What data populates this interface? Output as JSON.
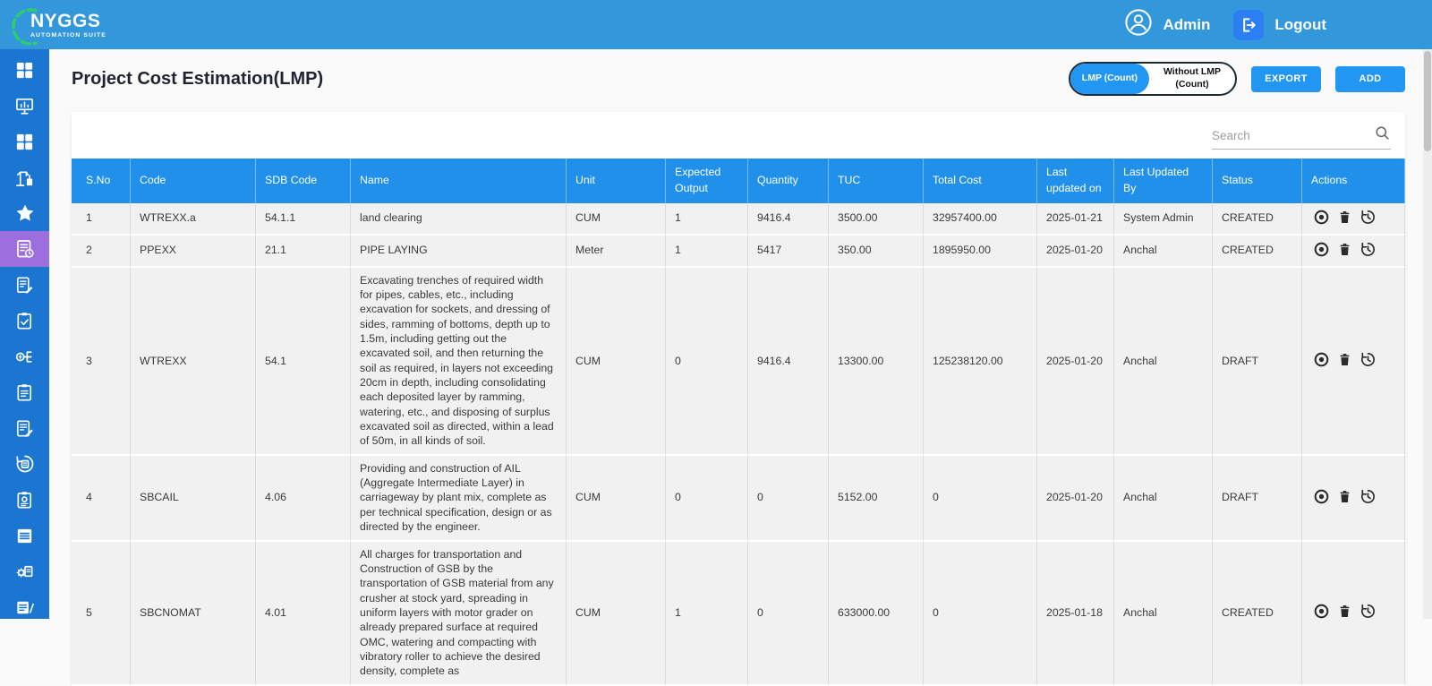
{
  "navbar": {
    "brand": "NYGGS",
    "brand_sub": "AUTOMATION SUITE",
    "user_label": "Admin",
    "logout_label": "Logout"
  },
  "sidebar": {
    "items": [
      {
        "icon": "dashboard-grid-icon",
        "active": false
      },
      {
        "icon": "monitor-chart-icon",
        "active": false
      },
      {
        "icon": "apps-grid-icon",
        "active": false
      },
      {
        "icon": "crane-icon",
        "active": false
      },
      {
        "icon": "star-icon",
        "active": false
      },
      {
        "icon": "invoice-calculator-icon",
        "active": true
      },
      {
        "icon": "document-pen-icon",
        "active": false
      },
      {
        "icon": "clipboard-check-icon",
        "active": false
      },
      {
        "icon": "money-flow-icon",
        "active": false
      },
      {
        "icon": "clipboard-doc-icon",
        "active": false
      },
      {
        "icon": "document-edit-icon",
        "active": false
      },
      {
        "icon": "sync-document-icon",
        "active": false
      },
      {
        "icon": "clipboard-gear-icon",
        "active": false
      },
      {
        "icon": "lines-document-icon",
        "active": false
      },
      {
        "icon": "gear-document-icon",
        "active": false
      },
      {
        "icon": "paper-pencil-icon",
        "active": false
      }
    ]
  },
  "page": {
    "title": "Project Cost Estimation(LMP)",
    "toggle_active": "LMP (Count)",
    "toggle_inactive": "Without LMP (Count)",
    "export_label": "EXPORT",
    "add_label": "ADD"
  },
  "search": {
    "placeholder": "Search"
  },
  "table": {
    "columns": [
      "S.No",
      "Code",
      "SDB Code",
      "Name",
      "Unit",
      "Expected Output",
      "Quantity",
      "TUC",
      "Total Cost",
      "Last updated on",
      "Last Updated By",
      "Status",
      "Actions"
    ],
    "action_icons": [
      "view-icon",
      "delete-icon",
      "history-icon"
    ],
    "rows": [
      {
        "cells": [
          "1",
          "WTREXX.a",
          "54.1.1",
          "land clearing",
          "CUM",
          "1",
          "9416.4",
          "3500.00",
          "32957400.00",
          "2025-01-21",
          "System Admin",
          "CREATED"
        ]
      },
      {
        "cells": [
          "2",
          "PPEXX",
          "21.1",
          "PIPE LAYING",
          "Meter",
          "1",
          "5417",
          "350.00",
          "1895950.00",
          "2025-01-20",
          "Anchal",
          "CREATED"
        ]
      },
      {
        "cells": [
          "3",
          "WTREXX",
          "54.1",
          "Excavating trenches of required width for pipes, cables, etc., including excavation for sockets, and dressing of sides, ramming of bottoms, depth up to 1.5m, including getting out the excavated soil, and then returning the soil as required, in layers not exceeding 20cm in depth, including consolidating each deposited layer by ramming, watering, etc., and disposing of surplus excavated soil as directed, within a lead of 50m, in all kinds of soil.",
          "CUM",
          "0",
          "9416.4",
          "13300.00",
          "125238120.00",
          "2025-01-20",
          "Anchal",
          "DRAFT"
        ]
      },
      {
        "cells": [
          "4",
          "SBCAIL",
          "4.06",
          "Providing and construction of AIL (Aggregate Intermediate Layer) in carriageway by plant mix, complete as per technical specification, design or as directed by the engineer.",
          "CUM",
          "0",
          "0",
          "5152.00",
          "0",
          "2025-01-20",
          "Anchal",
          "DRAFT"
        ]
      },
      {
        "cells": [
          "5",
          "SBCNOMAT",
          "4.01",
          "All charges for transportation and Construction of GSB by the transportation of GSB material from any crusher at stock yard, spreading in uniform layers with motor grader on already prepared surface at required OMC, watering and compacting with vibratory roller to achieve the desired density, complete as",
          "CUM",
          "1",
          "0",
          "633000.00",
          "0",
          "2025-01-18",
          "Anchal",
          "CREATED"
        ]
      }
    ]
  },
  "colors": {
    "navbar": "#3398db",
    "sidebar": "#1b76d1",
    "active_item": "#9d6edd",
    "table_header": "#2090ea",
    "accent_button": "#2196f3",
    "logo_arc_green": "#2ecc71"
  }
}
